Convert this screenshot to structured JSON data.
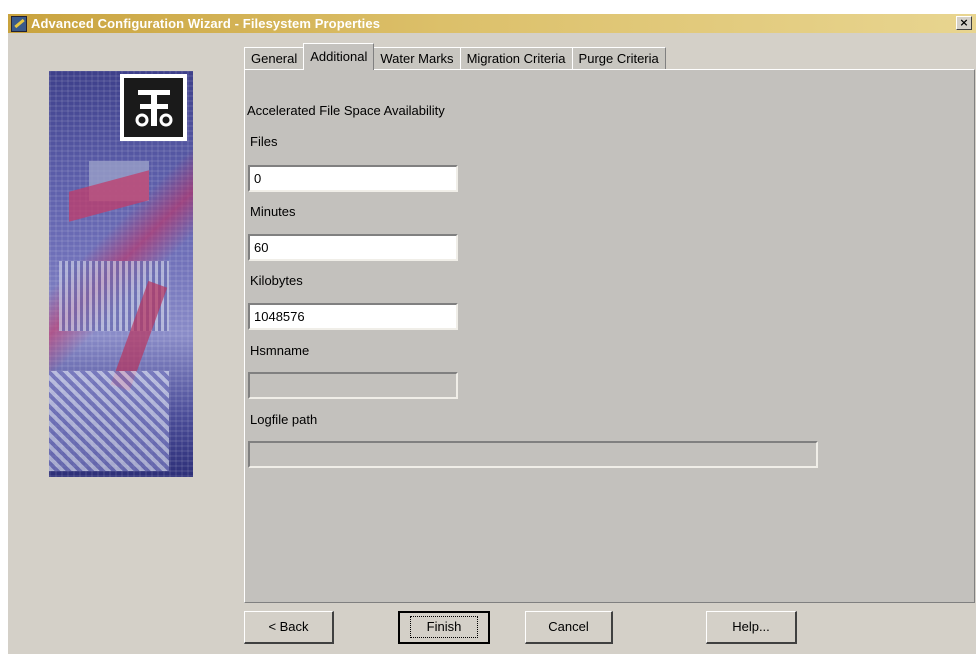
{
  "window": {
    "title": "Advanced Configuration Wizard - Filesystem Properties",
    "close_label": "×"
  },
  "tabs": [
    {
      "label": "General",
      "active": false
    },
    {
      "label": "Additional",
      "active": true
    },
    {
      "label": "Water Marks",
      "active": false
    },
    {
      "label": "Migration Criteria",
      "active": false
    },
    {
      "label": "Purge Criteria",
      "active": false
    }
  ],
  "form": {
    "section_title": "Accelerated File Space Availability",
    "files_label": "Files",
    "files_value": "0",
    "minutes_label": "Minutes",
    "minutes_value": "60",
    "kilobytes_label": "Kilobytes",
    "kilobytes_value": "1048576",
    "hsmname_label": "Hsmname",
    "hsmname_value": "",
    "logfile_label": "Logfile path",
    "logfile_value": ""
  },
  "buttons": {
    "back": "< Back",
    "finish": "Finish",
    "cancel": "Cancel",
    "help": "Help..."
  },
  "colors": {
    "titlebar_start": "#c9a33e",
    "titlebar_end": "#e8d590",
    "dialog_bg": "#d4d0c8",
    "panel_bg": "#c3c1bd"
  }
}
